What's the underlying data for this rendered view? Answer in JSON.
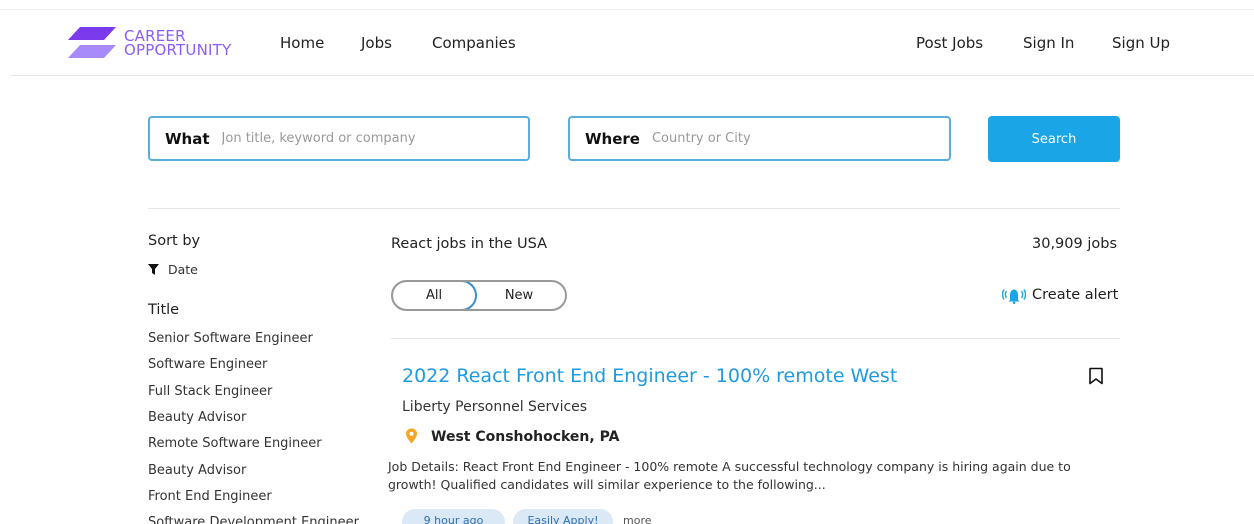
{
  "brand": {
    "line1": "CAREER",
    "line2": "OPPORTUNITY",
    "color": "#8b5cf6"
  },
  "nav": {
    "home": "Home",
    "jobs": "Jobs",
    "companies": "Companies",
    "post_jobs": "Post Jobs",
    "sign_in": "Sign In",
    "sign_up": "Sign Up"
  },
  "search": {
    "what_label": "What",
    "what_placeholder": "Jon title, keyword or company",
    "where_label": "Where",
    "where_placeholder": "Country or City",
    "button": "Search",
    "accent": "#1aa5e6"
  },
  "sidebar": {
    "sort_heading": "Sort by",
    "sort_icon": "filter-icon",
    "sort_value": "Date",
    "title_heading": "Title",
    "titles": [
      "Senior Software Engineer",
      "Software Engineer",
      "Full Stack Engineer",
      "Beauty Advisor",
      "Remote Software Engineer",
      "Beauty Advisor",
      "Front End Engineer",
      "Software Development Engineer"
    ]
  },
  "results": {
    "heading": "React jobs in the USA",
    "count": "30,909 jobs",
    "filter_all": "All",
    "filter_new": "New",
    "alert_icon": "bell-icon",
    "create_alert": "Create alert"
  },
  "job": {
    "title": "2022 React Front End Engineer - 100% remote West",
    "company": "Liberty Personnel Services",
    "location": "West Conshohocken, PA",
    "description": "Job Details: React Front End Engineer - 100% remote A successful technology company is hiring again due to growth! Qualified candidates will similar experience to the following...",
    "tags": [
      "9 hour ago",
      "Easily Apply!"
    ],
    "more": "more",
    "title_color": "#1e9be0",
    "pin_color": "#f5a623"
  }
}
